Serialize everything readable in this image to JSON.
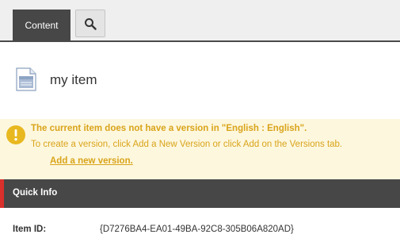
{
  "toolbar": {
    "content_tab": "Content",
    "search_icon": "search-icon"
  },
  "item": {
    "icon": "document-icon",
    "title": "my item"
  },
  "warning": {
    "icon": "exclamation-icon",
    "color": "#d9a41a",
    "background": "#fdf7de",
    "title": "The current item does not have a version in \"English : English\".",
    "text": "To create a version, click Add a New Version or click Add on the Versions tab.",
    "link": "Add a new version."
  },
  "quick_info": {
    "label": "Quick Info",
    "accent": "#d9302c",
    "rows": [
      {
        "label": "Item ID:",
        "value": "{D7276BA4-EA01-49BA-92C8-305B06A820AD}"
      }
    ]
  }
}
